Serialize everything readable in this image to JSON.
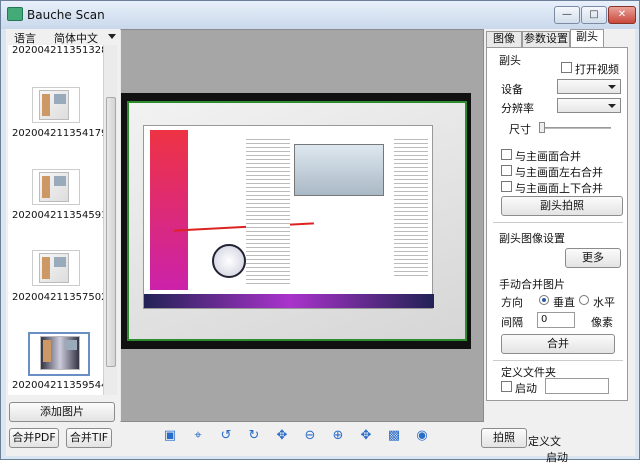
{
  "window": {
    "title": "Bauche Scan",
    "controls": [
      "minimize-icon",
      "maximize-icon",
      "close-icon"
    ]
  },
  "left": {
    "lang_label": "语言",
    "lang_value": "简体中文",
    "thumbnails": [
      "2020042113513​28...",
      "2020042113541​79...",
      "2020042113545​91...",
      "2020042113575​02...",
      "2020042113595​44..."
    ],
    "add_image": "添加图片",
    "merge_pdf": "合并PDF",
    "merge_tif": "合并TIF"
  },
  "toolbar": {
    "icons": [
      "focus-icon",
      "crop-icon",
      "rotate-left-icon",
      "rotate-right-icon",
      "move-icon",
      "zoom-out-icon",
      "zoom-in-icon",
      "pan-icon",
      "film-icon",
      "compare-icon"
    ],
    "capture": "拍照"
  },
  "right": {
    "tabs": [
      "图像",
      "参数设置",
      "副头"
    ],
    "sub_title": "副头",
    "open_video": "打开视频",
    "device_label": "设备",
    "resolution_label": "分辨率",
    "size_label": "尺寸",
    "merge_main": "与主画面合并",
    "merge_lr": "与主画面左右合并",
    "merge_tb": "与主画面上下合并",
    "sub_capture": "副头拍照",
    "sub_image_settings": "副头图像设置",
    "more": "更多",
    "manual_merge": "手动合并图片",
    "direction_label": "方向",
    "vertical": "垂直",
    "horizontal": "水平",
    "interval_label": "间隔",
    "interval_value": "0",
    "pixels_unit": "像素",
    "merge_button": "合并",
    "custom_folder": "定义文件夹",
    "enable": "启动",
    "ghost_custom": "定义文",
    "ghost_enable": "启动"
  }
}
